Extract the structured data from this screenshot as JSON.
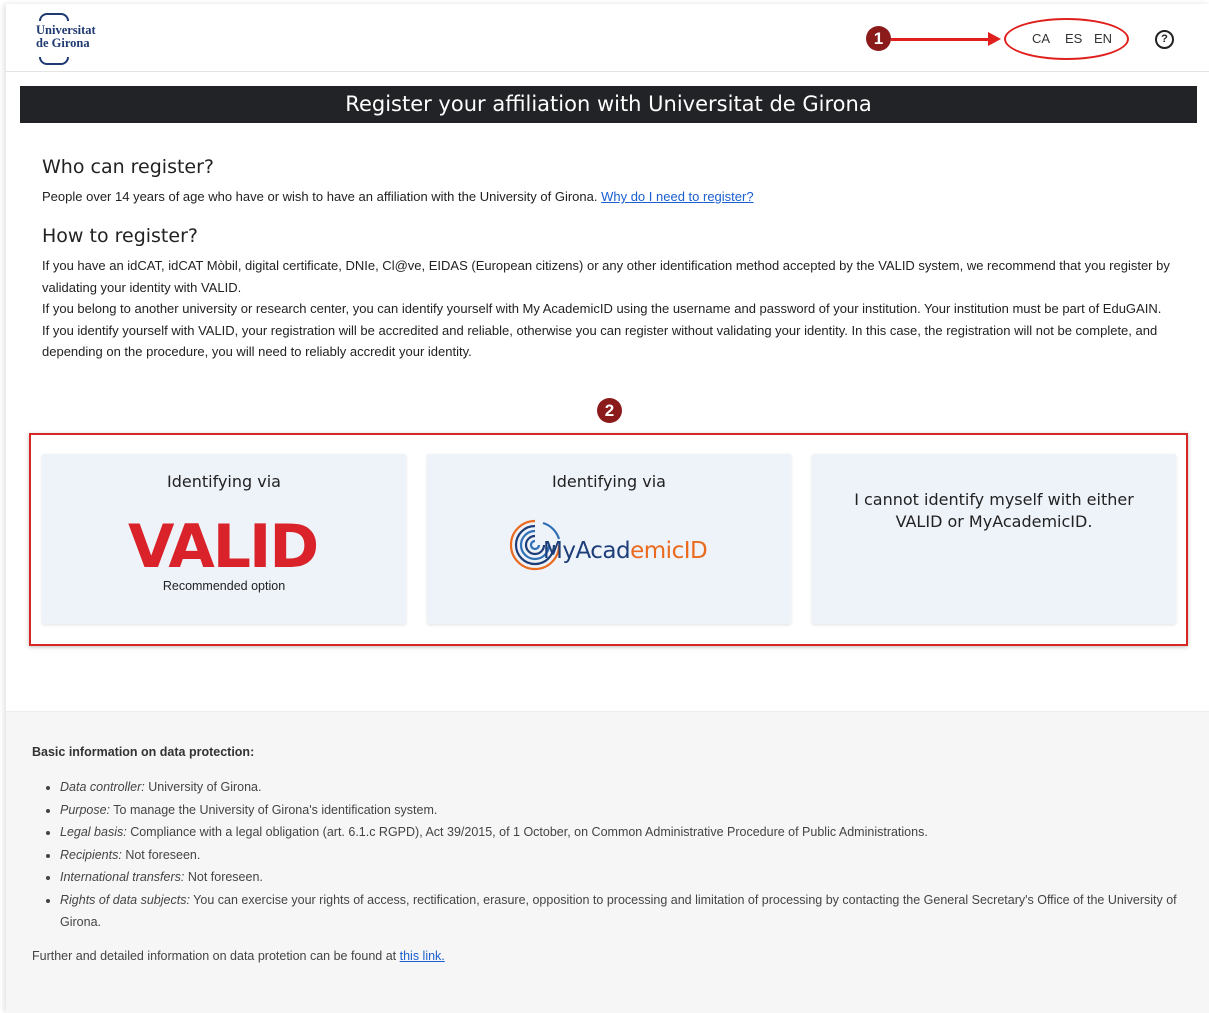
{
  "header": {
    "logo_line1": "Universitat",
    "logo_line2": "de Girona",
    "badge1": "1",
    "languages": [
      "CA",
      "ES",
      "EN"
    ],
    "help_icon_glyph": "?",
    "accent_color": "#e0201d"
  },
  "title_bar": "Register your affiliation with Universitat de Girona",
  "who": {
    "heading": "Who can register?",
    "text": "People over 14 years of age who have or wish to have an affiliation with the University of Girona.",
    "link": "Why do I need to register?"
  },
  "how": {
    "heading": "How to register?",
    "p1": "If you have an idCAT, idCAT Mòbil, digital certificate, DNIe, Cl@ve, EIDAS (European citizens) or any other identification method accepted by the VALID system, we recommend that you register by validating your identity with VALID.",
    "p2": "If you belong to another university or research center, you can identify yourself with My AcademicID using the username and password of your institution. Your institution must be part of EduGAIN.",
    "p3": "If you identify yourself with VALID, your registration will be accredited and reliable, otherwise you can register without validating your identity. In this case, the registration will not be complete, and depending on the procedure, you will need to reliably accredit your identity."
  },
  "badge2": "2",
  "options": {
    "valid": {
      "title": "Identifying via",
      "logo": "VALID",
      "subtitle": "Recommended option"
    },
    "myacademicid": {
      "title": "Identifying via",
      "logo_part1": "MyAcad",
      "logo_part2": "emic",
      "logo_part3": "ID"
    },
    "none": {
      "title": "I cannot identify myself with either VALID or MyAcademicID."
    }
  },
  "footer": {
    "heading": "Basic information on data protection:",
    "items": [
      {
        "label": "Data controller:",
        "text": " University of Girona."
      },
      {
        "label": "Purpose:",
        "text": " To manage the University of Girona's identification system."
      },
      {
        "label": "Legal basis:",
        "text": " Compliance with a legal obligation (art. 6.1.c RGPD), Act 39/2015, of 1 October, on Common Administrative Procedure of Public Administrations."
      },
      {
        "label": "Recipients:",
        "text": " Not foreseen."
      },
      {
        "label": "International transfers:",
        "text": " Not foreseen."
      },
      {
        "label": "Rights of data subjects:",
        "text": " You can exercise your rights of access, rectification, erasure, opposition to processing and limitation of processing by contacting the General Secretary's Office of the University of Girona."
      }
    ],
    "more_text": "Further and detailed information on data protetion can be found at",
    "more_link": "this link."
  }
}
